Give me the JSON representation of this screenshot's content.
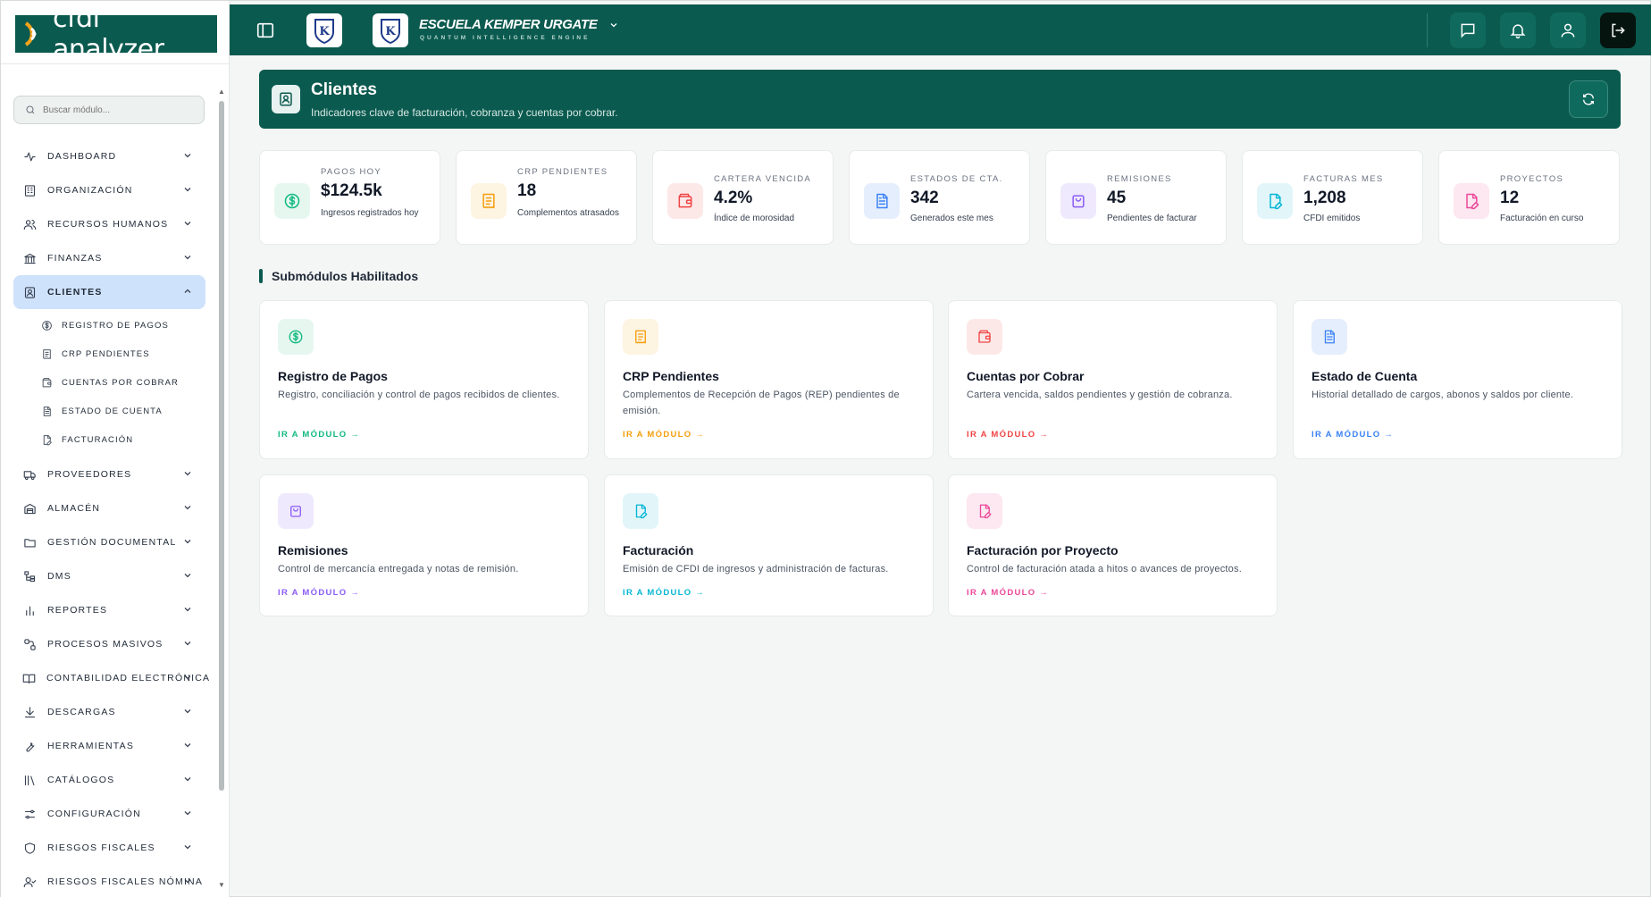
{
  "app": {
    "logo_text": "cfdi analyzer",
    "search_placeholder": "Buscar módulo..."
  },
  "topbar": {
    "school_name": "ESCUELA KEMPER URGATE",
    "tagline": "QUANTUM INTELLIGENCE ENGINE"
  },
  "sidebar": {
    "items": [
      {
        "label": "DASHBOARD",
        "icon": "activity-icon"
      },
      {
        "label": "ORGANIZACIÓN",
        "icon": "building-icon"
      },
      {
        "label": "RECURSOS HUMANOS",
        "icon": "users-icon"
      },
      {
        "label": "FINANZAS",
        "icon": "bank-icon"
      },
      {
        "label": "CLIENTES",
        "icon": "contact-icon",
        "active": true
      },
      {
        "label": "PROVEEDORES",
        "icon": "truck-icon"
      },
      {
        "label": "ALMACÉN",
        "icon": "warehouse-icon"
      },
      {
        "label": "GESTIÓN DOCUMENTAL",
        "icon": "folder-icon"
      },
      {
        "label": "DMS",
        "icon": "tree-icon"
      },
      {
        "label": "REPORTES",
        "icon": "bar-chart-icon"
      },
      {
        "label": "PROCESOS MASIVOS",
        "icon": "workflow-icon"
      },
      {
        "label": "CONTABILIDAD ELECTRÓNICA",
        "icon": "book-icon"
      },
      {
        "label": "DESCARGAS",
        "icon": "download-icon"
      },
      {
        "label": "HERRAMIENTAS",
        "icon": "wrench-icon"
      },
      {
        "label": "CATÁLOGOS",
        "icon": "library-icon"
      },
      {
        "label": "CONFIGURACIÓN",
        "icon": "sliders-icon"
      },
      {
        "label": "RIESGOS FISCALES",
        "icon": "shield-icon"
      },
      {
        "label": "RIESGOS FISCALES NÓMINA",
        "icon": "user-check-icon"
      }
    ],
    "clientes_sub": [
      {
        "label": "REGISTRO DE PAGOS",
        "icon": "dollar-icon"
      },
      {
        "label": "CRP PENDIENTES",
        "icon": "receipt-icon"
      },
      {
        "label": "CUENTAS POR COBRAR",
        "icon": "wallet-icon"
      },
      {
        "label": "ESTADO DE CUENTA",
        "icon": "file-text-icon"
      },
      {
        "label": "FACTURACIÓN",
        "icon": "file-pen-icon"
      }
    ]
  },
  "banner": {
    "title": "Clientes",
    "subtitle": "Indicadores clave de facturación, cobranza y cuentas por cobrar."
  },
  "kpis": [
    {
      "label": "PAGOS HOY",
      "value": "$124.5k",
      "sub": "Ingresos registrados hoy",
      "color": "#10b981",
      "bg": "#e6f7f0",
      "icon": "dollar-icon"
    },
    {
      "label": "CRP PENDIENTES",
      "value": "18",
      "sub": "Complementos atrasados",
      "color": "#f59e0b",
      "bg": "#fef4e2",
      "icon": "receipt-icon"
    },
    {
      "label": "CARTERA VENCIDA",
      "value": "4.2%",
      "sub": "Índice de morosidad",
      "color": "#ef4444",
      "bg": "#fde8e8",
      "icon": "wallet-icon"
    },
    {
      "label": "ESTADOS DE CTA.",
      "value": "342",
      "sub": "Generados este mes",
      "color": "#3b82f6",
      "bg": "#e5eefc",
      "icon": "file-text-icon"
    },
    {
      "label": "REMISIONES",
      "value": "45",
      "sub": "Pendientes de facturar",
      "color": "#8b5cf6",
      "bg": "#efe9fd",
      "icon": "bag-icon"
    },
    {
      "label": "FACTURAS MES",
      "value": "1,208",
      "sub": "CFDI emitidos",
      "color": "#06b6d4",
      "bg": "#e2f6fa",
      "icon": "file-pen-icon"
    },
    {
      "label": "PROYECTOS",
      "value": "12",
      "sub": "Facturación en curso",
      "color": "#ec4899",
      "bg": "#fde7f1",
      "icon": "file-pen-icon"
    }
  ],
  "section": {
    "title": "Submódulos Habilitados"
  },
  "cards": [
    {
      "title": "Registro de Pagos",
      "desc": "Registro, conciliación y control de pagos recibidos de clientes.",
      "link": "IR A MÓDULO →",
      "color": "#10b981",
      "bg": "#e6f7f0",
      "icon": "dollar-icon"
    },
    {
      "title": "CRP Pendientes",
      "desc": "Complementos de Recepción de Pagos (REP) pendientes de emisión.",
      "link": "IR A MÓDULO →",
      "color": "#f59e0b",
      "bg": "#fef4e2",
      "icon": "receipt-icon"
    },
    {
      "title": "Cuentas por Cobrar",
      "desc": "Cartera vencida, saldos pendientes y gestión de cobranza.",
      "link": "IR A MÓDULO →",
      "color": "#ef4444",
      "bg": "#fde8e8",
      "icon": "wallet-icon"
    },
    {
      "title": "Estado de Cuenta",
      "desc": "Historial detallado de cargos, abonos y saldos por cliente.",
      "link": "IR A MÓDULO →",
      "color": "#3b82f6",
      "bg": "#e5eefc",
      "icon": "file-text-icon"
    },
    {
      "title": "Remisiones",
      "desc": "Control de mercancía entregada y notas de remisión.",
      "link": "IR A MÓDULO →",
      "color": "#8b5cf6",
      "bg": "#efe9fd",
      "icon": "bag-icon"
    },
    {
      "title": "Facturación",
      "desc": "Emisión de CFDI de ingresos y administración de facturas.",
      "link": "IR A MÓDULO →",
      "color": "#06b6d4",
      "bg": "#e2f6fa",
      "icon": "file-pen-icon"
    },
    {
      "title": "Facturación por Proyecto",
      "desc": "Control de facturación atada a hitos o avances de proyectos.",
      "link": "IR A MÓDULO →",
      "color": "#ec4899",
      "bg": "#fde7f1",
      "icon": "file-pen-icon"
    }
  ]
}
